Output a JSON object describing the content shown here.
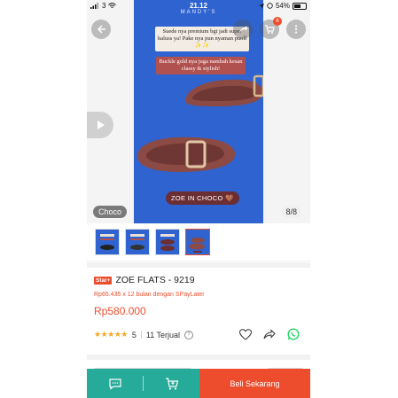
{
  "statusbar": {
    "carrier": "3",
    "time": "21.12",
    "battery": "54%"
  },
  "hero": {
    "brand": "MANDY'S",
    "caption_1": "Suede nya premium bgt jadi super haluss ya! Pake nya pun nyaman puoll ✨✨",
    "caption_2": "Buckle gold nya juga nambah kesan classy & stylish!",
    "caption_3": "ZOE IN CHOCO 🤎",
    "variant_label": "Choco",
    "pager": "8/8",
    "cart_count": "6"
  },
  "thumbnails": [
    {
      "name": "thumb-1",
      "active": false
    },
    {
      "name": "thumb-2",
      "active": false
    },
    {
      "name": "thumb-3",
      "active": false
    },
    {
      "name": "thumb-4",
      "active": true
    }
  ],
  "product": {
    "badge": "Star+",
    "title": "ZOE FLATS - 9219",
    "installment": "Rp65.435 x 12 bulan dengan SPayLater",
    "price": "Rp580.000",
    "stars": "★★★★★",
    "rating": "5",
    "sold": "11 Terjual",
    "help_glyph": "?"
  },
  "bottom_bar": {
    "buy_label": "Beli Sekarang"
  },
  "colors": {
    "brand_orange": "#ee4d2d",
    "teal": "#26aa99",
    "photo_blue": "#2f63d0",
    "shoe_brown": "#8c4a45"
  }
}
